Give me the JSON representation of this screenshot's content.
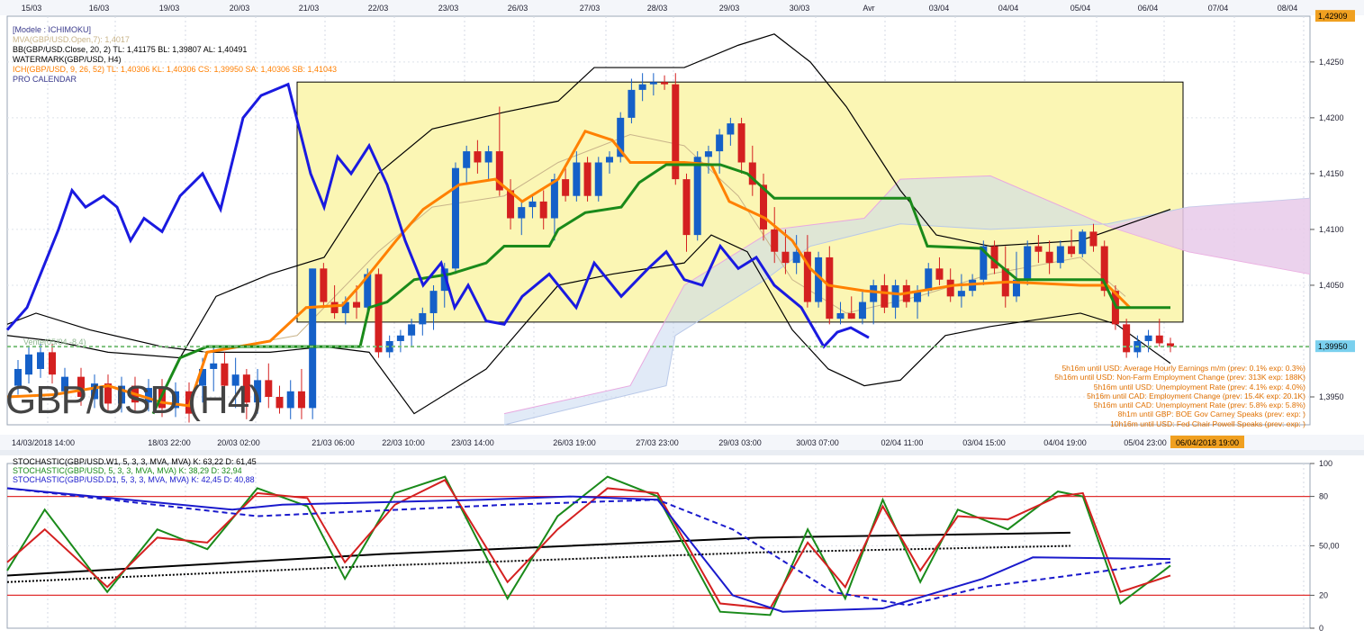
{
  "top_dates": [
    "15/03",
    "16/03",
    "19/03",
    "20/03",
    "21/03",
    "22/03",
    "23/03",
    "26/03",
    "27/03",
    "28/03",
    "29/03",
    "30/03",
    "Avr",
    "03/04",
    "04/04",
    "05/04",
    "06/04",
    "07/04",
    "08/04"
  ],
  "bottom_dates": [
    "14/03/2018 14:00",
    "18/03 22:00",
    "20/03 02:00",
    "21/03 06:00",
    "22/03 10:00",
    "23/03 14:00",
    "26/03 19:00",
    "27/03 23:00",
    "29/03 03:00",
    "30/03 07:00",
    "02/04 11:00",
    "03/04 15:00",
    "04/04 19:00",
    "05/04 23:00"
  ],
  "cursor_date": "06/04/2018 19:00",
  "legend_main": [
    {
      "text": "[Modele : ICHIMOKU]",
      "color": "#3a3a8c"
    },
    {
      "text": "MVA(GBP/USD.Open,7): 1,4017",
      "color": "#c9b48a"
    },
    {
      "text": "BB(GBP/USD.Close, 20, 2)  TL: 1,41175  BL: 1,39807  AL: 1,40491",
      "color": "#000000"
    },
    {
      "text": "WATERMARK(GBP/USD, H4)",
      "color": "#000000"
    },
    {
      "text": "ICH(GBP/USD, 9, 26, 52)  TL: 1,40306  KL: 1,40306  CS: 1,39950  SA: 1,40306  SB: 1,41043",
      "color": "#ff7f00"
    },
    {
      "text": "PRO CALENDAR",
      "color": "#3a3a8c"
    }
  ],
  "price_axis": {
    "ticks": [
      "1,4250",
      "1,4200",
      "1,4150",
      "1,4100",
      "1,4050",
      "1,3950"
    ],
    "top_label": "1,42909",
    "current_label": "1,39950"
  },
  "watermark": "GBP/USD (H4)",
  "sell_label": "Vente(05/04,-8,4)",
  "calendar_events": [
    "5h16m until USD: Average Hourly Earnings m/m (prev: 0.1% exp: 0.3%)",
    "5h16m until USD: Non-Farm Employment Change (prev: 313K exp: 188K)",
    "5h16m until USD: Unemployment Rate (prev: 4.1% exp: 4.0%)",
    "5h16m until CAD: Employment Change (prev: 15.4K exp: 20.1K)",
    "5h16m until CAD: Unemployment Rate (prev: 5.8% exp: 5.8%)",
    "8h1m until GBP: BOE Gov Carney Speaks (prev:  exp: )",
    "10h16m until USD: Fed Chair Powell Speaks (prev:  exp: )"
  ],
  "legend_stoch": [
    {
      "text": "STOCHASTIC(GBP/USD.W1, 5, 3, 3, MVA, MVA)  K: 63,22  D: 61,45",
      "color": "#000000"
    },
    {
      "text": "STOCHASTIC(GBP/USD, 5, 3, 3, MVA, MVA)  K: 38,29  D: 32,94",
      "color": "#1a8a1a"
    },
    {
      "text": "STOCHASTIC(GBP/USD.D1, 5, 3, 3, MVA, MVA)  K: 42,45  D: 40,88",
      "color": "#1a1acc"
    }
  ],
  "stoch_axis": {
    "ticks": [
      "100",
      "80",
      "50,00",
      "20",
      "0"
    ]
  },
  "colors": {
    "bull": "#1560c8",
    "bear": "#d42020",
    "tenkan": "#1a1ae0",
    "kijun": "#ff8000",
    "chikou": "#1a8a1a",
    "cloud_bull": "#c8d8f0",
    "cloud_bear": "#f0c8e8",
    "box": "#fbf6b4"
  },
  "chart_data": [
    {
      "type": "candlestick",
      "symbol": "GBP/USD",
      "timeframe": "H4",
      "ylim": [
        1.3925,
        1.4291
      ],
      "current_price": 1.3995,
      "candles": [
        {
          "o": 1.396,
          "h": 1.3985,
          "l": 1.3945,
          "c": 1.3975
        },
        {
          "o": 1.3975,
          "h": 1.3995,
          "l": 1.3955,
          "c": 1.398
        },
        {
          "o": 1.398,
          "h": 1.399,
          "l": 1.395,
          "c": 1.396
        },
        {
          "o": 1.396,
          "h": 1.3985,
          "l": 1.394,
          "c": 1.397
        },
        {
          "o": 1.397,
          "h": 1.3975,
          "l": 1.393,
          "c": 1.3945
        },
        {
          "o": 1.3945,
          "h": 1.3975,
          "l": 1.3935,
          "c": 1.3965
        },
        {
          "o": 1.3965,
          "h": 1.398,
          "l": 1.394,
          "c": 1.395
        },
        {
          "o": 1.395,
          "h": 1.396,
          "l": 1.3935,
          "c": 1.394
        },
        {
          "o": 1.394,
          "h": 1.3965,
          "l": 1.393,
          "c": 1.3955
        },
        {
          "o": 1.3955,
          "h": 1.3975,
          "l": 1.393,
          "c": 1.394
        },
        {
          "o": 1.394,
          "h": 1.4065,
          "l": 1.393,
          "c": 1.4065
        },
        {
          "o": 1.4065,
          "h": 1.407,
          "l": 1.403,
          "c": 1.4035
        },
        {
          "o": 1.4035,
          "h": 1.405,
          "l": 1.402,
          "c": 1.4025
        },
        {
          "o": 1.4025,
          "h": 1.404,
          "l": 1.4015,
          "c": 1.4035
        },
        {
          "o": 1.4035,
          "h": 1.405,
          "l": 1.402,
          "c": 1.403
        },
        {
          "o": 1.403,
          "h": 1.4065,
          "l": 1.4025,
          "c": 1.406
        },
        {
          "o": 1.406,
          "h": 1.4065,
          "l": 1.3985,
          "c": 1.399
        },
        {
          "o": 1.399,
          "h": 1.4005,
          "l": 1.3985,
          "c": 1.4
        },
        {
          "o": 1.4,
          "h": 1.401,
          "l": 1.399,
          "c": 1.4005
        },
        {
          "o": 1.4005,
          "h": 1.402,
          "l": 1.3995,
          "c": 1.4015
        },
        {
          "o": 1.4015,
          "h": 1.403,
          "l": 1.4005,
          "c": 1.4025
        },
        {
          "o": 1.4025,
          "h": 1.405,
          "l": 1.401,
          "c": 1.4045
        },
        {
          "o": 1.4045,
          "h": 1.407,
          "l": 1.403,
          "c": 1.4065
        },
        {
          "o": 1.4065,
          "h": 1.416,
          "l": 1.406,
          "c": 1.4155
        },
        {
          "o": 1.4155,
          "h": 1.4175,
          "l": 1.414,
          "c": 1.417
        },
        {
          "o": 1.417,
          "h": 1.418,
          "l": 1.415,
          "c": 1.416
        },
        {
          "o": 1.416,
          "h": 1.4175,
          "l": 1.4145,
          "c": 1.417
        },
        {
          "o": 1.417,
          "h": 1.421,
          "l": 1.413,
          "c": 1.4135
        },
        {
          "o": 1.4135,
          "h": 1.4145,
          "l": 1.41,
          "c": 1.411
        },
        {
          "o": 1.411,
          "h": 1.4125,
          "l": 1.4095,
          "c": 1.412
        },
        {
          "o": 1.412,
          "h": 1.413,
          "l": 1.411,
          "c": 1.4125
        },
        {
          "o": 1.4125,
          "h": 1.4135,
          "l": 1.41,
          "c": 1.411
        },
        {
          "o": 1.411,
          "h": 1.415,
          "l": 1.409,
          "c": 1.4145
        },
        {
          "o": 1.4145,
          "h": 1.4155,
          "l": 1.4125,
          "c": 1.413
        },
        {
          "o": 1.413,
          "h": 1.417,
          "l": 1.4125,
          "c": 1.416
        },
        {
          "o": 1.416,
          "h": 1.4165,
          "l": 1.4125,
          "c": 1.413
        },
        {
          "o": 1.413,
          "h": 1.4165,
          "l": 1.4125,
          "c": 1.416
        },
        {
          "o": 1.416,
          "h": 1.417,
          "l": 1.415,
          "c": 1.4165
        },
        {
          "o": 1.4165,
          "h": 1.4205,
          "l": 1.416,
          "c": 1.42
        },
        {
          "o": 1.42,
          "h": 1.4235,
          "l": 1.4195,
          "c": 1.4225
        },
        {
          "o": 1.4225,
          "h": 1.424,
          "l": 1.4215,
          "c": 1.423
        },
        {
          "o": 1.423,
          "h": 1.424,
          "l": 1.422,
          "c": 1.4232
        },
        {
          "o": 1.4232,
          "h": 1.4238,
          "l": 1.4225,
          "c": 1.423
        },
        {
          "o": 1.423,
          "h": 1.424,
          "l": 1.414,
          "c": 1.4145
        },
        {
          "o": 1.4145,
          "h": 1.415,
          "l": 1.408,
          "c": 1.4095
        },
        {
          "o": 1.4095,
          "h": 1.417,
          "l": 1.409,
          "c": 1.4165
        },
        {
          "o": 1.4165,
          "h": 1.4175,
          "l": 1.415,
          "c": 1.417
        },
        {
          "o": 1.417,
          "h": 1.419,
          "l": 1.415,
          "c": 1.4185
        },
        {
          "o": 1.4185,
          "h": 1.42,
          "l": 1.4175,
          "c": 1.4195
        },
        {
          "o": 1.4195,
          "h": 1.42,
          "l": 1.415,
          "c": 1.416
        },
        {
          "o": 1.416,
          "h": 1.4175,
          "l": 1.413,
          "c": 1.414
        },
        {
          "o": 1.414,
          "h": 1.415,
          "l": 1.409,
          "c": 1.41
        },
        {
          "o": 1.41,
          "h": 1.412,
          "l": 1.407,
          "c": 1.408
        },
        {
          "o": 1.408,
          "h": 1.41,
          "l": 1.406,
          "c": 1.407
        },
        {
          "o": 1.407,
          "h": 1.4095,
          "l": 1.406,
          "c": 1.408
        },
        {
          "o": 1.408,
          "h": 1.4095,
          "l": 1.403,
          "c": 1.4035
        },
        {
          "o": 1.4035,
          "h": 1.408,
          "l": 1.403,
          "c": 1.4075
        },
        {
          "o": 1.4075,
          "h": 1.4085,
          "l": 1.4015,
          "c": 1.402
        },
        {
          "o": 1.402,
          "h": 1.4035,
          "l": 1.4015,
          "c": 1.4025
        },
        {
          "o": 1.4025,
          "h": 1.404,
          "l": 1.402,
          "c": 1.402
        },
        {
          "o": 1.402,
          "h": 1.4045,
          "l": 1.4015,
          "c": 1.4035
        },
        {
          "o": 1.4035,
          "h": 1.4055,
          "l": 1.4015,
          "c": 1.405
        },
        {
          "o": 1.405,
          "h": 1.406,
          "l": 1.4025,
          "c": 1.403
        },
        {
          "o": 1.403,
          "h": 1.4055,
          "l": 1.402,
          "c": 1.405
        },
        {
          "o": 1.405,
          "h": 1.4055,
          "l": 1.403,
          "c": 1.4035
        },
        {
          "o": 1.4035,
          "h": 1.405,
          "l": 1.402,
          "c": 1.4045
        },
        {
          "o": 1.4045,
          "h": 1.407,
          "l": 1.404,
          "c": 1.4065
        },
        {
          "o": 1.4065,
          "h": 1.4075,
          "l": 1.405,
          "c": 1.4055
        },
        {
          "o": 1.4055,
          "h": 1.4065,
          "l": 1.4035,
          "c": 1.404
        },
        {
          "o": 1.404,
          "h": 1.406,
          "l": 1.403,
          "c": 1.4045
        },
        {
          "o": 1.4045,
          "h": 1.406,
          "l": 1.404,
          "c": 1.4055
        },
        {
          "o": 1.4055,
          "h": 1.409,
          "l": 1.405,
          "c": 1.4085
        },
        {
          "o": 1.4085,
          "h": 1.409,
          "l": 1.406,
          "c": 1.4065
        },
        {
          "o": 1.4065,
          "h": 1.4085,
          "l": 1.403,
          "c": 1.404
        },
        {
          "o": 1.404,
          "h": 1.408,
          "l": 1.4035,
          "c": 1.4055
        },
        {
          "o": 1.4055,
          "h": 1.409,
          "l": 1.405,
          "c": 1.4085
        },
        {
          "o": 1.4085,
          "h": 1.4095,
          "l": 1.407,
          "c": 1.408
        },
        {
          "o": 1.408,
          "h": 1.409,
          "l": 1.406,
          "c": 1.407
        },
        {
          "o": 1.407,
          "h": 1.409,
          "l": 1.4065,
          "c": 1.4085
        },
        {
          "o": 1.4085,
          "h": 1.41,
          "l": 1.4075,
          "c": 1.4078
        },
        {
          "o": 1.4078,
          "h": 1.41,
          "l": 1.4075,
          "c": 1.4098
        },
        {
          "o": 1.4098,
          "h": 1.4105,
          "l": 1.408,
          "c": 1.4085
        },
        {
          "o": 1.4085,
          "h": 1.409,
          "l": 1.404,
          "c": 1.4045
        },
        {
          "o": 1.4045,
          "h": 1.405,
          "l": 1.401,
          "c": 1.4015
        },
        {
          "o": 1.4015,
          "h": 1.402,
          "l": 1.3985,
          "c": 1.399
        },
        {
          "o": 1.399,
          "h": 1.4005,
          "l": 1.3985,
          "c": 1.4
        },
        {
          "o": 1.4,
          "h": 1.401,
          "l": 1.399,
          "c": 1.4005
        },
        {
          "o": 1.4005,
          "h": 1.402,
          "l": 1.3995,
          "c": 1.3998
        },
        {
          "o": 1.3998,
          "h": 1.4003,
          "l": 1.399,
          "c": 1.3995
        }
      ]
    },
    {
      "type": "line",
      "title": "STOCHASTIC",
      "ylim": [
        0,
        100
      ],
      "levels": [
        80,
        20
      ],
      "series": [
        {
          "name": "STOCHASTIC(GBP/USD.W1, 5, 3, 3, MVA, MVA) K",
          "style": "solid",
          "color": "#000000",
          "points": [
            [
              0,
              32
            ],
            [
              30,
              45
            ],
            [
              60,
              55
            ],
            [
              85,
              58
            ]
          ]
        },
        {
          "name": "STOCHASTIC(GBP/USD.W1, 5, 3, 3, MVA, MVA) D",
          "style": "dotted",
          "color": "#000000",
          "points": [
            [
              0,
              28
            ],
            [
              30,
              38
            ],
            [
              60,
              46
            ],
            [
              85,
              50
            ]
          ]
        },
        {
          "name": "STOCHASTIC(GBP/USD, 5, 3, 3, MVA, MVA) K",
          "style": "solid",
          "color": "#1a8a1a",
          "points": [
            [
              0,
              35
            ],
            [
              3,
              72
            ],
            [
              8,
              22
            ],
            [
              12,
              60
            ],
            [
              16,
              48
            ],
            [
              20,
              85
            ],
            [
              24,
              74
            ],
            [
              27,
              30
            ],
            [
              31,
              82
            ],
            [
              35,
              92
            ],
            [
              40,
              18
            ],
            [
              44,
              68
            ],
            [
              48,
              92
            ],
            [
              52,
              80
            ],
            [
              57,
              10
            ],
            [
              61,
              8
            ],
            [
              64,
              60
            ],
            [
              67,
              18
            ],
            [
              70,
              78
            ],
            [
              73,
              28
            ],
            [
              76,
              72
            ],
            [
              80,
              60
            ],
            [
              84,
              83
            ],
            [
              86,
              80
            ],
            [
              89,
              15
            ],
            [
              93,
              38
            ]
          ]
        },
        {
          "name": "STOCHASTIC(GBP/USD, 5, 3, 3, MVA, MVA) D",
          "style": "solid",
          "color": "#d42020",
          "points": [
            [
              0,
              40
            ],
            [
              3,
              60
            ],
            [
              8,
              25
            ],
            [
              12,
              55
            ],
            [
              16,
              52
            ],
            [
              20,
              82
            ],
            [
              24,
              79
            ],
            [
              27,
              40
            ],
            [
              31,
              75
            ],
            [
              35,
              90
            ],
            [
              40,
              28
            ],
            [
              44,
              60
            ],
            [
              48,
              85
            ],
            [
              52,
              82
            ],
            [
              57,
              15
            ],
            [
              61,
              12
            ],
            [
              64,
              52
            ],
            [
              67,
              25
            ],
            [
              70,
              74
            ],
            [
              73,
              35
            ],
            [
              76,
              68
            ],
            [
              80,
              66
            ],
            [
              84,
              80
            ],
            [
              86,
              82
            ],
            [
              89,
              22
            ],
            [
              93,
              32
            ]
          ]
        },
        {
          "name": "STOCHASTIC(GBP/USD.D1, 5, 3, 3, MVA, MVA) K",
          "style": "solid",
          "color": "#1a1acc",
          "points": [
            [
              0,
              85
            ],
            [
              18,
              72
            ],
            [
              22,
              75
            ],
            [
              38,
              78
            ],
            [
              45,
              80
            ],
            [
              52,
              78
            ],
            [
              58,
              20
            ],
            [
              62,
              10
            ],
            [
              70,
              12
            ],
            [
              78,
              30
            ],
            [
              82,
              43
            ],
            [
              93,
              42
            ]
          ]
        },
        {
          "name": "STOCHASTIC(GBP/USD.D1, 5, 3, 3, MVA, MVA) D",
          "style": "dashed",
          "color": "#1a1acc",
          "points": [
            [
              0,
              85
            ],
            [
              20,
              68
            ],
            [
              40,
              75
            ],
            [
              52,
              78
            ],
            [
              58,
              60
            ],
            [
              66,
              22
            ],
            [
              72,
              14
            ],
            [
              78,
              25
            ],
            [
              93,
              40
            ]
          ]
        }
      ]
    }
  ]
}
